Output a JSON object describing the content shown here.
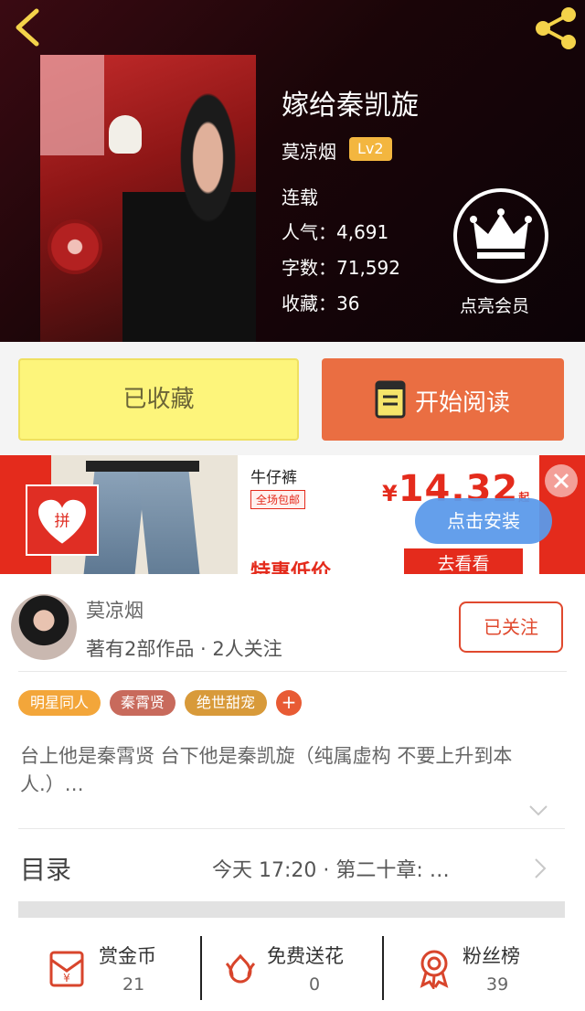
{
  "header": {
    "title": "嫁给秦凯旋",
    "author": "莫凉烟",
    "level": "Lv2",
    "status": "连载",
    "stats": [
      {
        "label": "人气：",
        "value": "4,691"
      },
      {
        "label": "字数：",
        "value": "71,592"
      },
      {
        "label": "收藏：",
        "value": "36"
      }
    ],
    "vip_label": "点亮会员",
    "icons": {
      "back": "back-chevron-icon",
      "share": "share-icon",
      "crown": "crown-icon"
    }
  },
  "actions": {
    "collected_label": "已收藏",
    "read_label": "开始阅读"
  },
  "ad": {
    "product": "牛仔裤",
    "free_shipping": "全场包邮",
    "special": "特惠低价",
    "price_symbol": "¥",
    "price": "14.32",
    "price_suffix": "起",
    "go_label": "去看看",
    "install_label": "点击安装",
    "logo_text": "拼"
  },
  "author_section": {
    "name": "莫凉烟",
    "summary": "著有2部作品 · 2人关注",
    "follow_label": "已关注"
  },
  "tags": [
    {
      "label": "明星同人",
      "color": "#f3a63a"
    },
    {
      "label": "秦霄贤",
      "color": "#c86a5c"
    },
    {
      "label": "绝世甜宠",
      "color": "#d89a3a"
    }
  ],
  "tag_add": "+",
  "synopsis": "台上他是秦霄贤 台下他是秦凯旋（纯属虚构 不要上升到本人.）…",
  "toc": {
    "label": "目录",
    "latest": "今天 17:20 · 第二十章: …"
  },
  "bottom": [
    {
      "label": "赏金币",
      "count": "21",
      "icon": "red-envelope-icon"
    },
    {
      "label": "免费送花",
      "count": "0",
      "icon": "flower-icon"
    },
    {
      "label": "粉丝榜",
      "count": "39",
      "icon": "medal-icon"
    }
  ],
  "colors": {
    "accent": "#ea6e42",
    "collected": "#fdf57b",
    "follow": "#e0492e"
  }
}
